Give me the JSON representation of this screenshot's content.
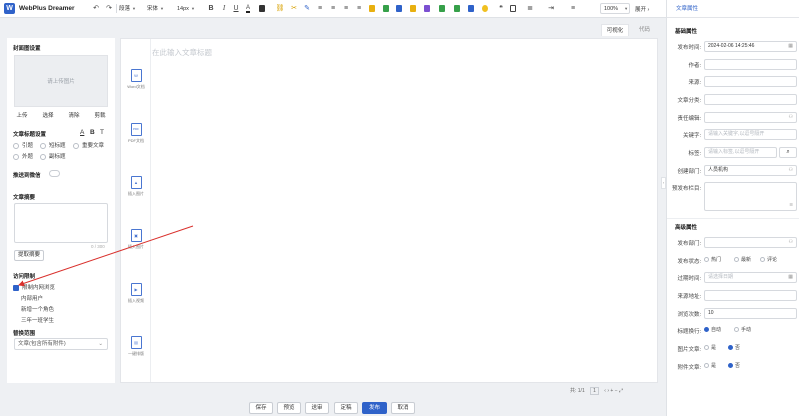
{
  "app": {
    "logo_letter": "W",
    "brand": "WebPlus  Dreamer"
  },
  "toolbar": {
    "paragraph": "段落",
    "font": "宋体",
    "size": "14px",
    "bold": "B",
    "italic": "I",
    "underline": "U",
    "font_color": "A",
    "zoom": "100%",
    "expand": "展开",
    "expand_arrow": "›"
  },
  "left_panel": {
    "cover_title": "封面图设置",
    "cover_upload": "请上传图片",
    "cover_buttons": [
      "上传",
      "选择",
      "清除",
      "剪裁"
    ],
    "title_settings": "文章标题设置",
    "title_icons": [
      "A",
      "B",
      "T"
    ],
    "title_options": [
      "引题",
      "短标题",
      "重要文章",
      "外题",
      "副标题"
    ],
    "push_wechat": "推送到微信",
    "summary_title": "文章摘要",
    "summary_count": "0 / 300",
    "extract_summary": "提取摘要",
    "access_title": "访问限制",
    "access_options": [
      "限制内网浏览",
      "内部用户",
      "新增一个角色",
      "三年一班学生"
    ],
    "replace_title": "替换范围",
    "replace_value": "文章(包含所有附件)",
    "caret": "⌄"
  },
  "editor": {
    "tabs": [
      "可视化",
      "代码"
    ],
    "title_placeholder": "在此输入文章标题",
    "insert_items": [
      {
        "icon": "W",
        "label": "Word文档"
      },
      {
        "icon": "PDF",
        "label": "PDF文档"
      },
      {
        "icon": "▲",
        "label": "插入图片"
      },
      {
        "icon": "▣",
        "label": "插入图片"
      },
      {
        "icon": "▶",
        "label": "插入视频"
      },
      {
        "icon": "▤",
        "label": "一键排版"
      }
    ],
    "status": {
      "pages": "共: 1/1",
      "page": "1",
      "nav": "‹ › + − ⤢"
    }
  },
  "bottom_buttons": [
    "保存",
    "预览",
    "送审",
    "定稿",
    "发布",
    "取消"
  ],
  "right_panel": {
    "header": "文章属性",
    "basic_title": "基础属性",
    "publish_time_label": "发布时间:",
    "publish_time": "2024-02-06 14:25:46",
    "author_label": "作者:",
    "source_label": "来源:",
    "category_label": "文章分类:",
    "editor_label": "责任编辑:",
    "keywords_label": "关键字:",
    "keywords_placeholder": "请输入关键字,以逗号隔开",
    "tags_label": "标签:",
    "tags_placeholder": "请输入标签,以逗号隔开",
    "dept_label": "创建部门:",
    "dept_value": "人员机构",
    "publish_column_label": "预发布栏目:",
    "advanced_title": "高级属性",
    "publish_dept_label": "发布部门:",
    "publish_status_label": "发布状态:",
    "publish_status_options": [
      "热门",
      "最新",
      "评论"
    ],
    "expire_label": "过期时间:",
    "expire_placeholder": "请选择日期",
    "source_url_label": "来源地址:",
    "views_label": "浏览次数:",
    "views_value": "10",
    "title_wrap_label": "标题换行:",
    "title_wrap_options": [
      "自动",
      "手动"
    ],
    "image_article_label": "图片文章:",
    "attach_article_label": "附件文章:",
    "yes_no": [
      "是",
      "否"
    ]
  },
  "colors": {
    "accent": "#2f62c9",
    "arrow": "#d9302c"
  }
}
